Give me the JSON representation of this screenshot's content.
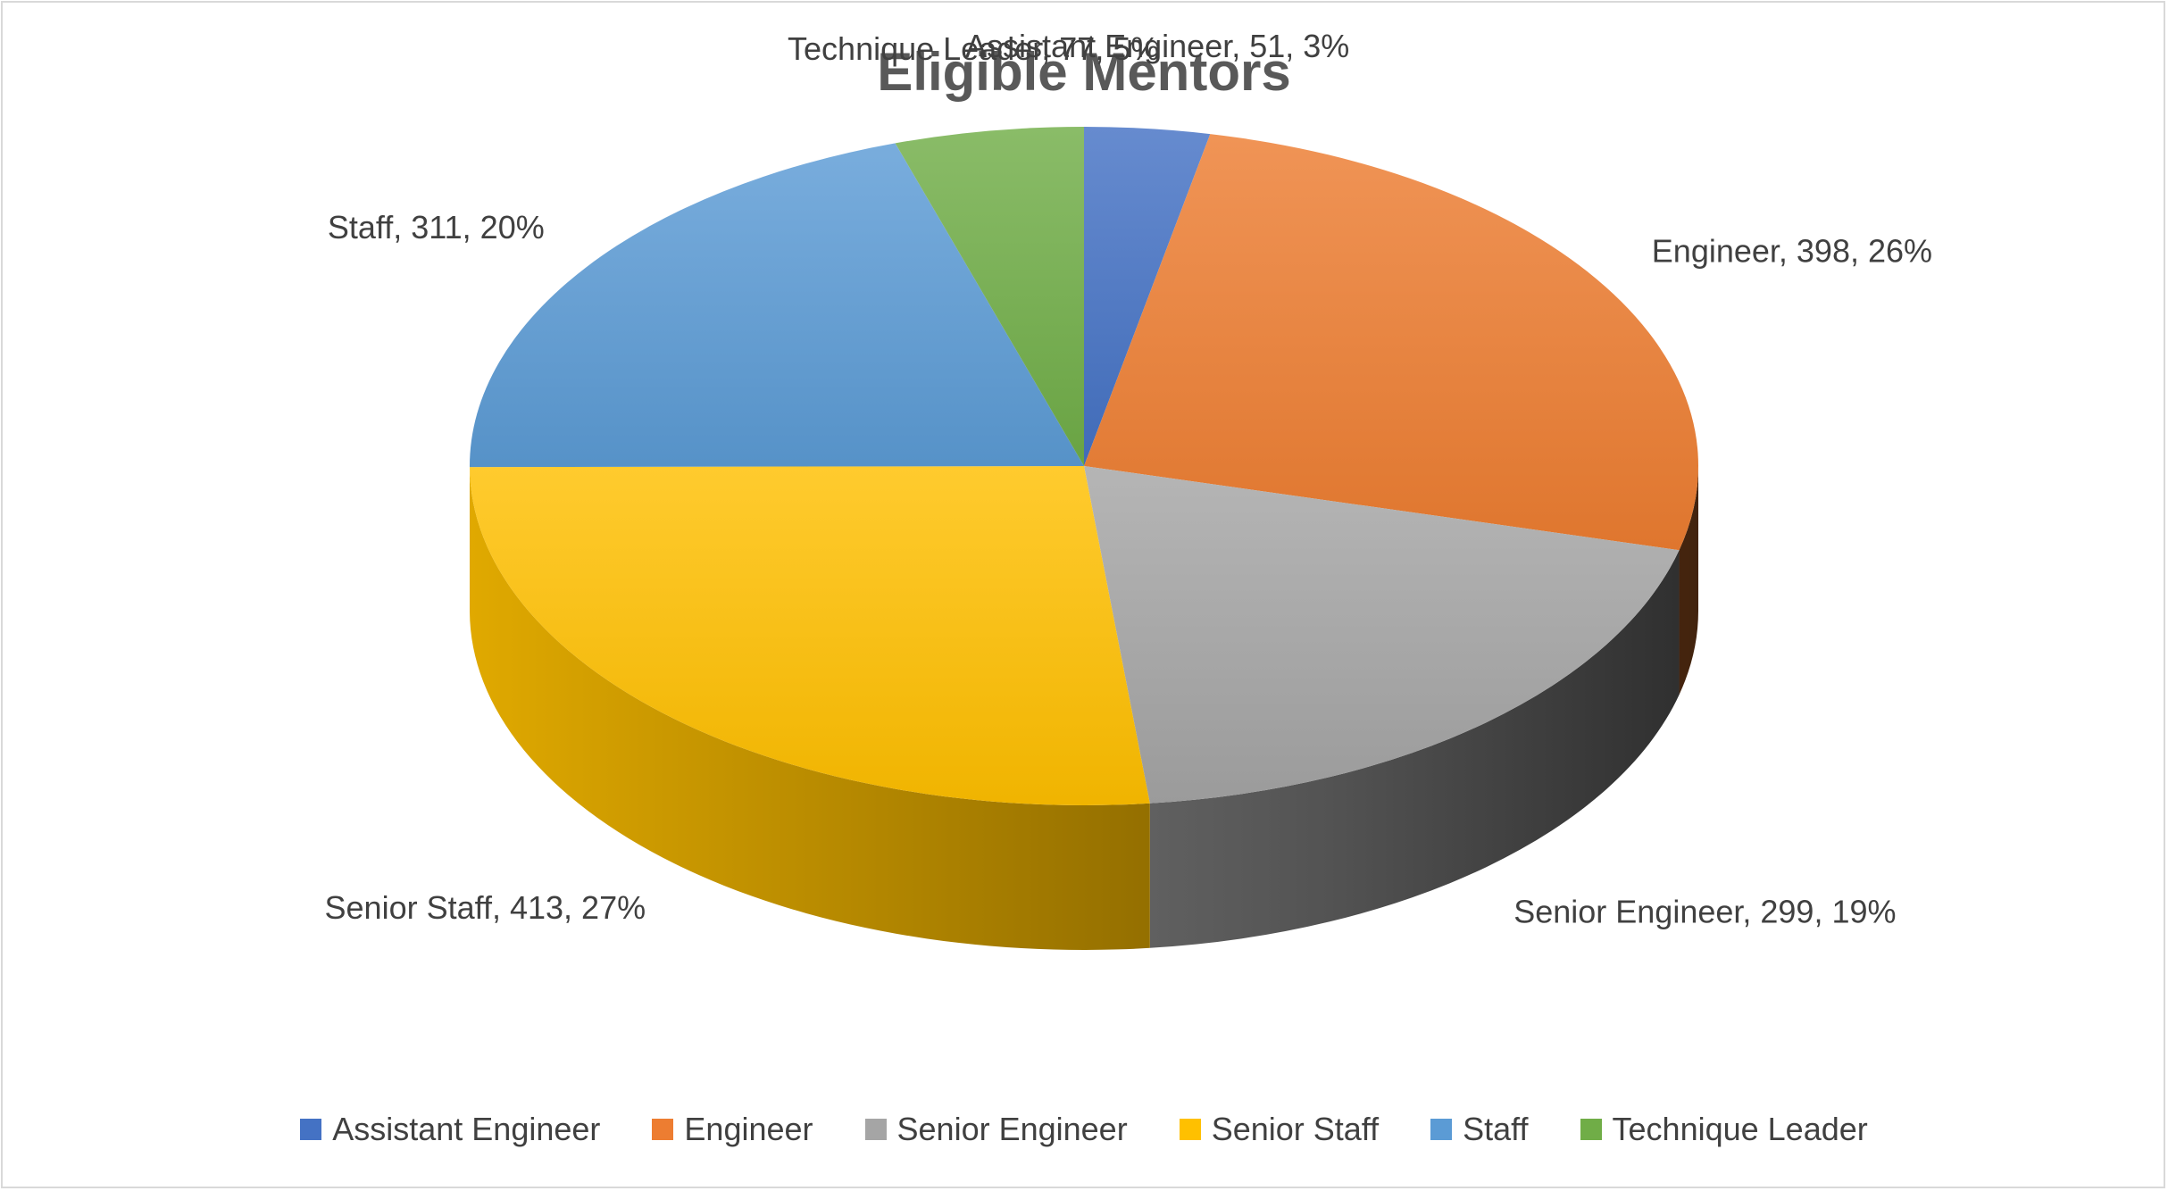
{
  "chart_data": {
    "type": "pie",
    "title": "Eligible Mentors",
    "categories": [
      "Assistant Engineer",
      "Engineer",
      "Senior Engineer",
      "Senior Staff",
      "Staff",
      "Technique Leader"
    ],
    "values": [
      51,
      398,
      299,
      413,
      311,
      77
    ],
    "percent_labels": [
      "3%",
      "26%",
      "19%",
      "27%",
      "20%",
      "5%"
    ],
    "data_labels": [
      "Assistant Engineer, 51, 3%",
      "Engineer, 398, 26%",
      "Senior Engineer, 299, 19%",
      "Senior Staff, 413, 27%",
      "Staff, 311, 20%",
      "Technique Leader, 77, 5%"
    ],
    "colors": [
      "#4472c4",
      "#ed7d31",
      "#a5a5a5",
      "#ffc000",
      "#5b9bd5",
      "#70ad47"
    ],
    "legend_position": "bottom",
    "three_d": true
  }
}
